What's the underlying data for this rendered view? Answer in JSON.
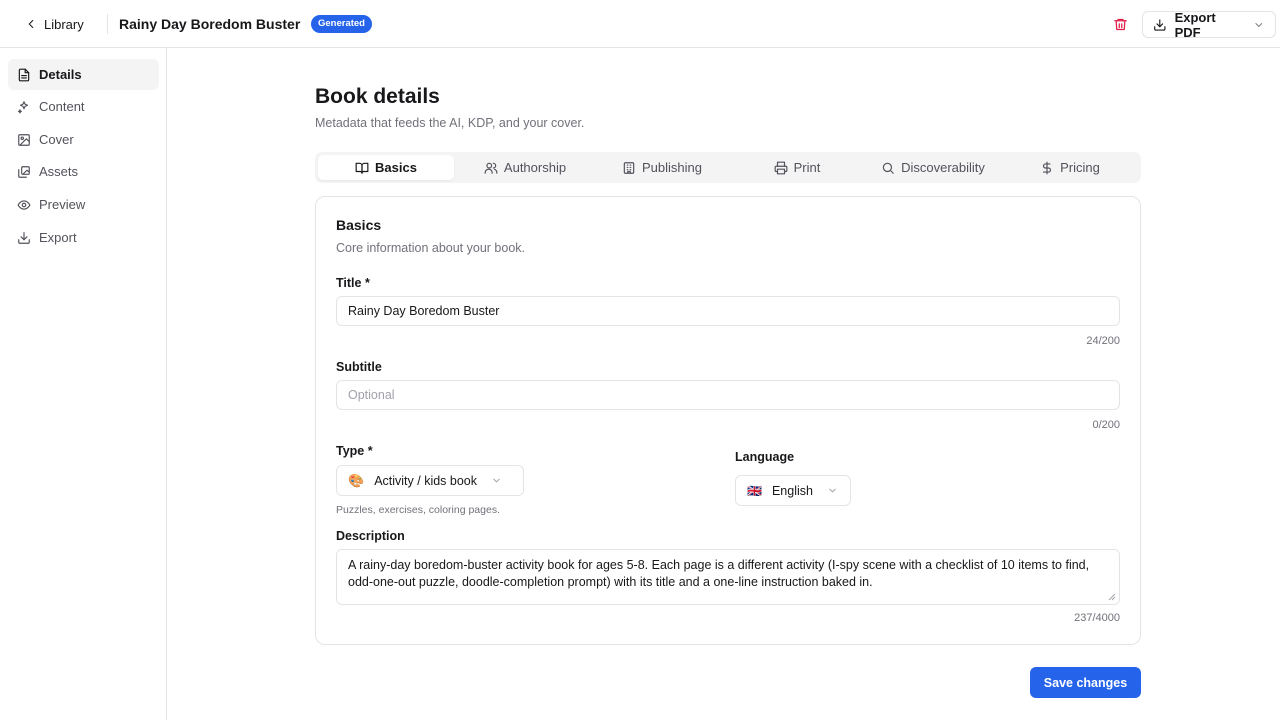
{
  "header": {
    "back_label": "Library",
    "title": "Rainy Day Boredom Buster",
    "badge": "Generated",
    "export_label": "Export PDF"
  },
  "sidebar": {
    "items": [
      {
        "label": "Details",
        "icon": "file-text-icon",
        "active": true
      },
      {
        "label": "Content",
        "icon": "sparkles-icon"
      },
      {
        "label": "Cover",
        "icon": "image-icon"
      },
      {
        "label": "Assets",
        "icon": "gallery-icon"
      },
      {
        "label": "Preview",
        "icon": "eye-icon"
      },
      {
        "label": "Export",
        "icon": "download-icon"
      }
    ]
  },
  "main": {
    "title": "Book details",
    "subtitle": "Metadata that feeds the AI, KDP, and your cover.",
    "tabs": [
      {
        "label": "Basics",
        "icon": "book-open-icon",
        "active": true
      },
      {
        "label": "Authorship",
        "icon": "users-icon"
      },
      {
        "label": "Publishing",
        "icon": "building-icon"
      },
      {
        "label": "Print",
        "icon": "printer-icon"
      },
      {
        "label": "Discoverability",
        "icon": "search-icon"
      },
      {
        "label": "Pricing",
        "icon": "dollar-icon"
      }
    ]
  },
  "form": {
    "section_title": "Basics",
    "section_sub": "Core information about your book.",
    "title_label": "Title *",
    "title_value": "Rainy Day Boredom Buster",
    "title_count": "24/200",
    "subtitle_label": "Subtitle",
    "subtitle_placeholder": "Optional",
    "subtitle_count": "0/200",
    "type_label": "Type *",
    "type_emoji": "🎨",
    "type_value": "Activity / kids book",
    "type_help": "Puzzles, exercises, coloring pages.",
    "language_label": "Language",
    "language_flag": "🇬🇧",
    "language_value": "English",
    "description_label": "Description",
    "description_value": "A rainy-day boredom-buster activity book for ages 5-8. Each page is a different activity (I-spy scene with a checklist of 10 items to find, odd-one-out puzzle, doodle-completion prompt) with its title and a one-line instruction baked in.",
    "description_count": "237/4000"
  },
  "actions": {
    "save_label": "Save changes"
  },
  "colors": {
    "accent": "#2563eb",
    "danger": "#e11d48",
    "border": "#e4e4e7",
    "muted": "#71717a"
  }
}
